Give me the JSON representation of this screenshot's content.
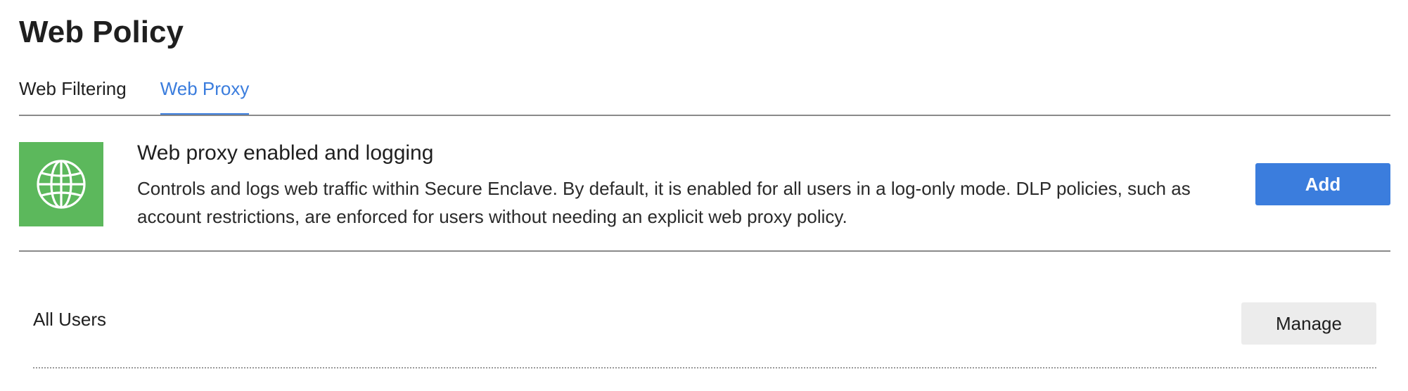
{
  "page": {
    "title": "Web Policy"
  },
  "tabs": [
    {
      "label": "Web Filtering",
      "active": false
    },
    {
      "label": "Web Proxy",
      "active": true
    }
  ],
  "policy": {
    "icon": "globe-icon",
    "icon_bg_color": "#5cb85c",
    "title": "Web proxy enabled and logging",
    "description": "Controls and logs web traffic within Secure Enclave. By default, it is enabled for all users in a log-only mode. DLP policies, such as account restrictions, are enforced for users without needing an explicit web proxy policy.",
    "add_label": "Add"
  },
  "rows": [
    {
      "label": "All Users",
      "action_label": "Manage"
    }
  ],
  "colors": {
    "accent": "#3b7ddd",
    "text": "#1f1f1f"
  }
}
